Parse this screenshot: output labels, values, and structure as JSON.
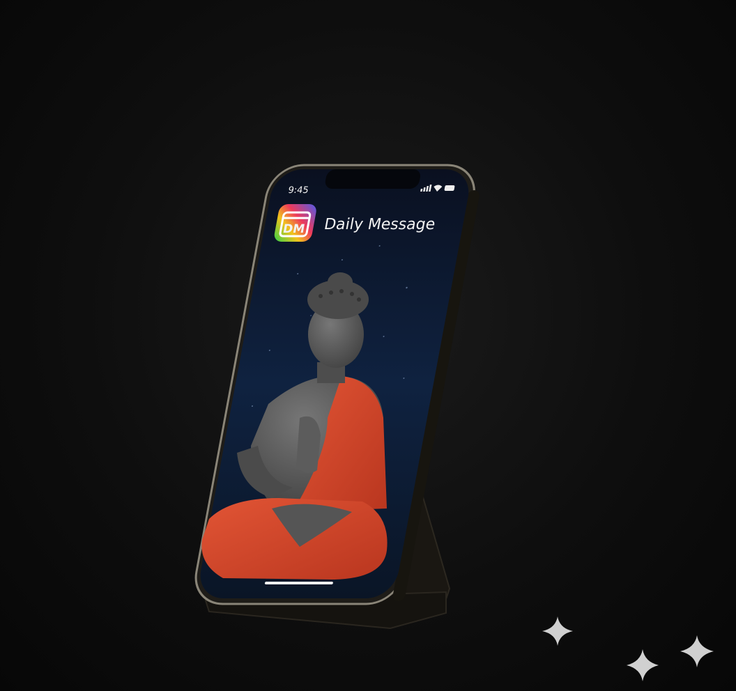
{
  "phone": {
    "status_time": "9:45",
    "status_icons": [
      "signal-icon",
      "wifi-icon",
      "battery-icon"
    ],
    "app_icon_text": "DM",
    "app_title": "Daily Message"
  },
  "colors": {
    "background": "#0e0e0e",
    "screen": "#0c1a33",
    "robe": "#d4472c",
    "statue": "#5a5a5a"
  }
}
